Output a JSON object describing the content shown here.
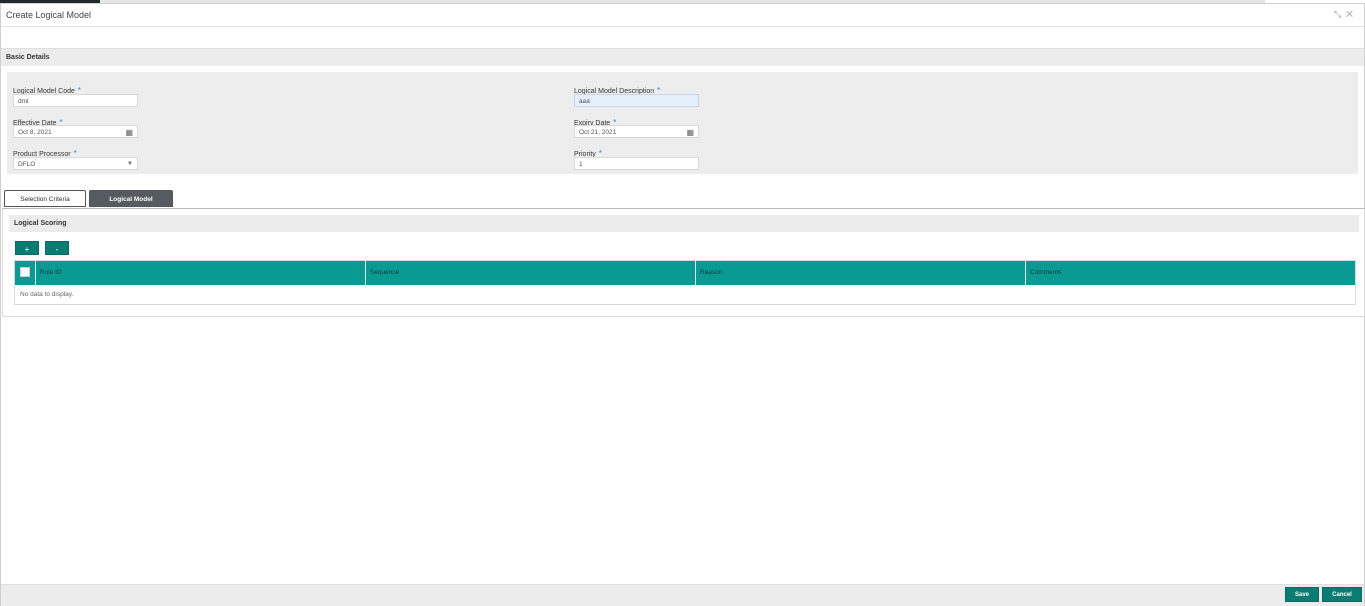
{
  "window": {
    "title": "Create Logical Model",
    "controls": "⤡ ✕"
  },
  "basic_details": {
    "heading": "Basic Details",
    "logical_model_code": {
      "label": "Logical Model Code",
      "value": "dml"
    },
    "logical_model_description": {
      "label": "Logical Model Description",
      "value": "aaa"
    },
    "effective_date": {
      "label": "Effective Date",
      "value": "Oct 8, 2021"
    },
    "expiry_date": {
      "label": "Expiry Date",
      "value": "Oct 21, 2021"
    },
    "product_processor": {
      "label": "Product Processor",
      "value": "DFLO"
    },
    "priority": {
      "label": "Priority",
      "value": "1"
    },
    "required_marker": "*"
  },
  "tabs": [
    {
      "label": "Selection Criteria",
      "selected": false
    },
    {
      "label": "Logical Model",
      "selected": true
    }
  ],
  "logical_scoring": {
    "heading": "Logical Scoring",
    "add_label": "+",
    "remove_label": "-",
    "columns": [
      "Rule ID",
      "Sequence",
      "Reason",
      "Comments"
    ],
    "empty_text": "No data to display."
  },
  "footer": {
    "save_label": "Save",
    "cancel_label": "Cancel"
  },
  "colors": {
    "accent": "#0a7d73",
    "grid_header": "#0a9a94",
    "required": "#2a8ad8"
  },
  "icons": {
    "calendar": "calendar-icon",
    "dropdown": "chevron-down-icon",
    "minimize": "minimize-icon",
    "close": "close-icon"
  }
}
